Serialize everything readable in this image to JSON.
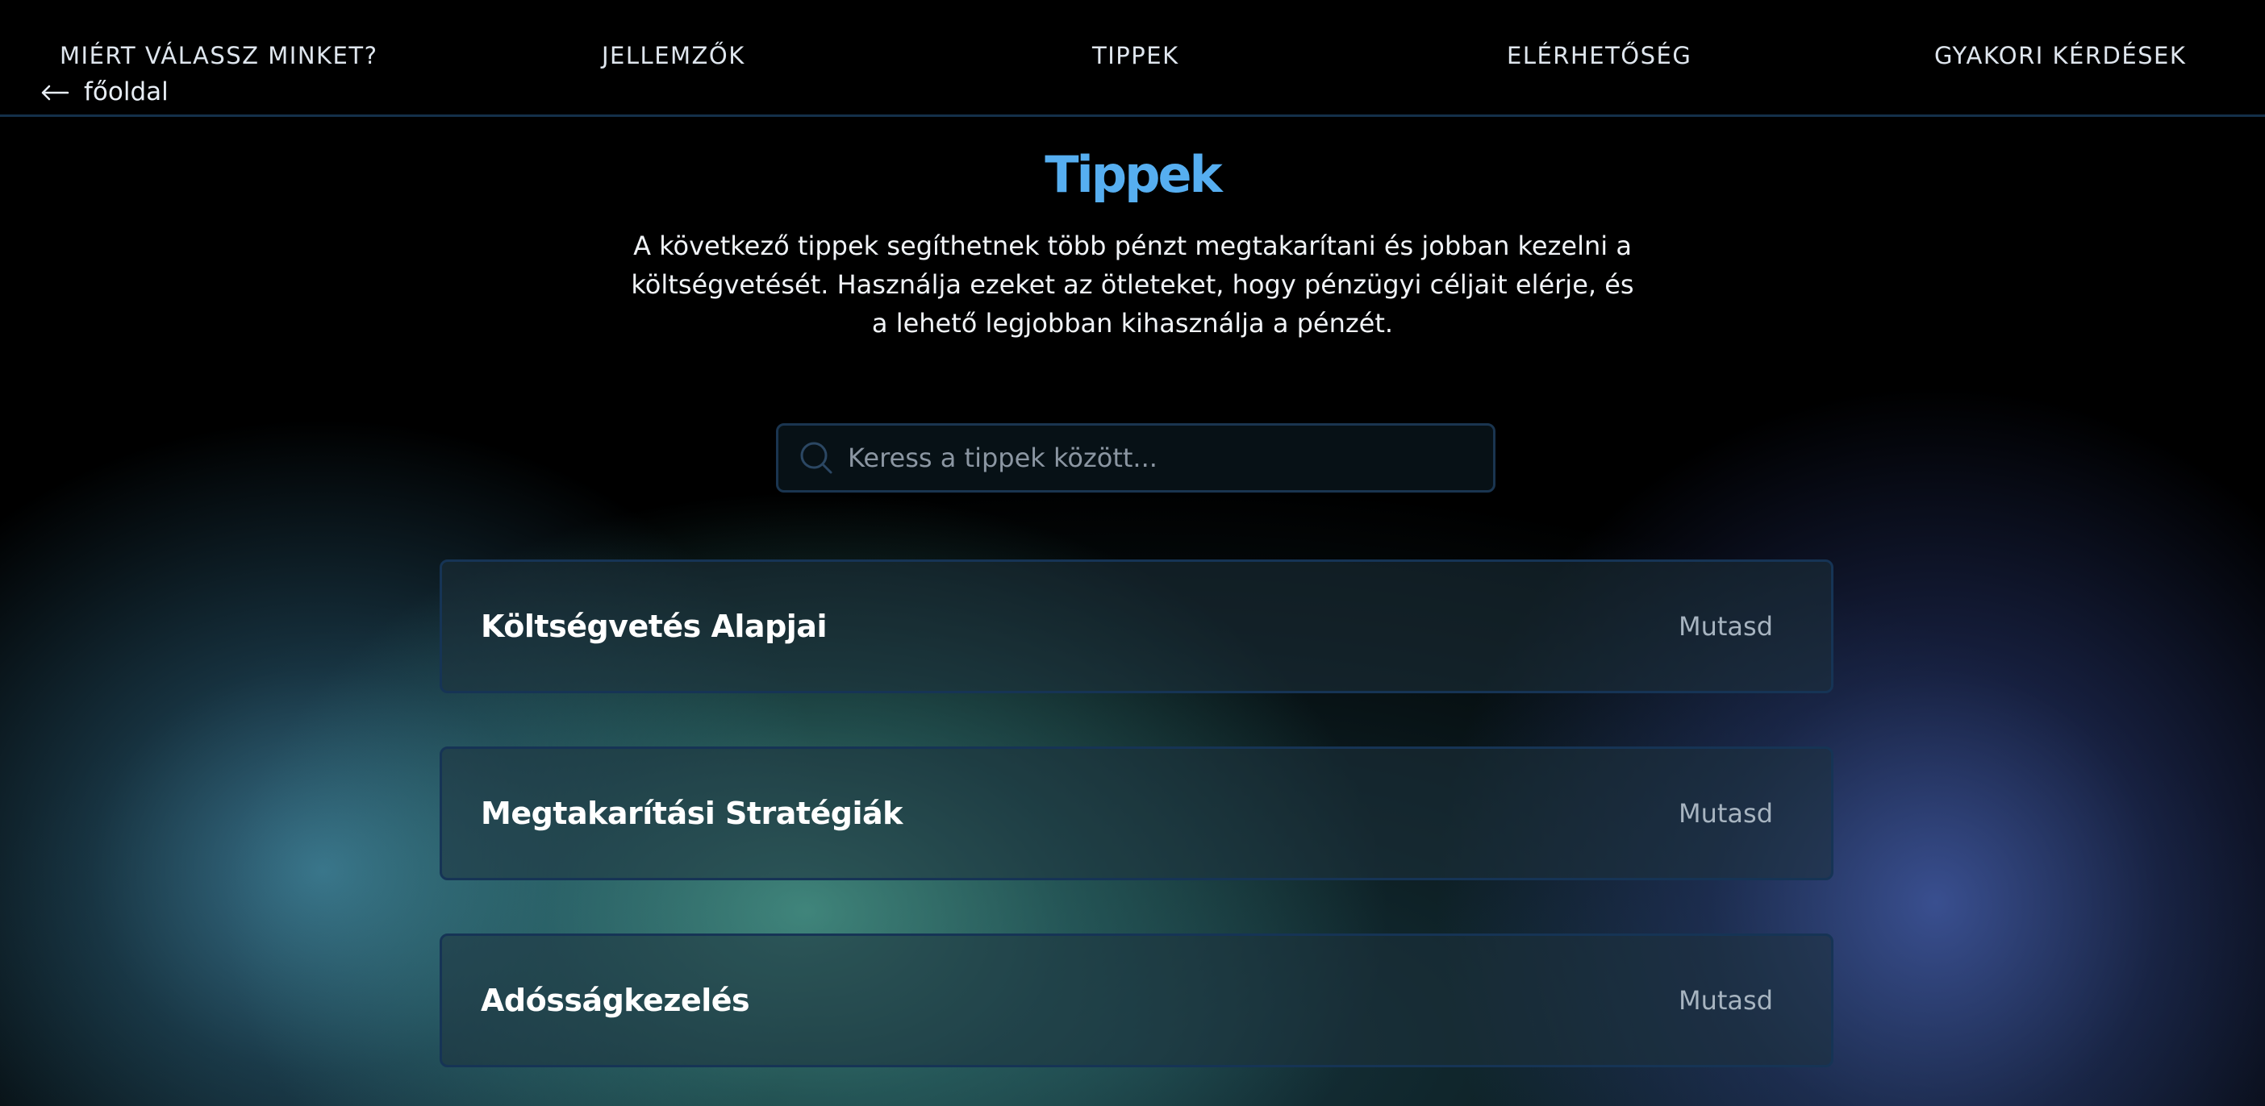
{
  "nav": {
    "items": [
      {
        "label": "MIÉRT VÁLASSZ MINKET?"
      },
      {
        "label": "JELLEMZŐK"
      },
      {
        "label": "TIPPEK"
      },
      {
        "label": "ELÉRHETŐSÉG"
      },
      {
        "label": "GYAKORI KÉRDÉSEK"
      }
    ],
    "back_label": "főoldal",
    "back_icon": "arrow-left-icon"
  },
  "main": {
    "title": "Tippek",
    "description": "A következő tippek segíthetnek több pénzt megtakarítani és jobban kezelni a költségvetését. Használja ezeket az ötleteket, hogy pénzügyi céljait elérje, és a lehető legjobban kihasználja a pénzét.",
    "search": {
      "placeholder": "Keress a tippek között...",
      "value": "",
      "icon": "search-icon"
    },
    "tips": [
      {
        "title": "Költségvetés Alapjai",
        "toggle": "Mutasd"
      },
      {
        "title": "Megtakarítási Stratégiák",
        "toggle": "Mutasd"
      },
      {
        "title": "Adósságkezelés",
        "toggle": "Mutasd"
      }
    ]
  },
  "colors": {
    "accent": "#56aef0",
    "background": "#000000",
    "card_border": "#163455"
  }
}
